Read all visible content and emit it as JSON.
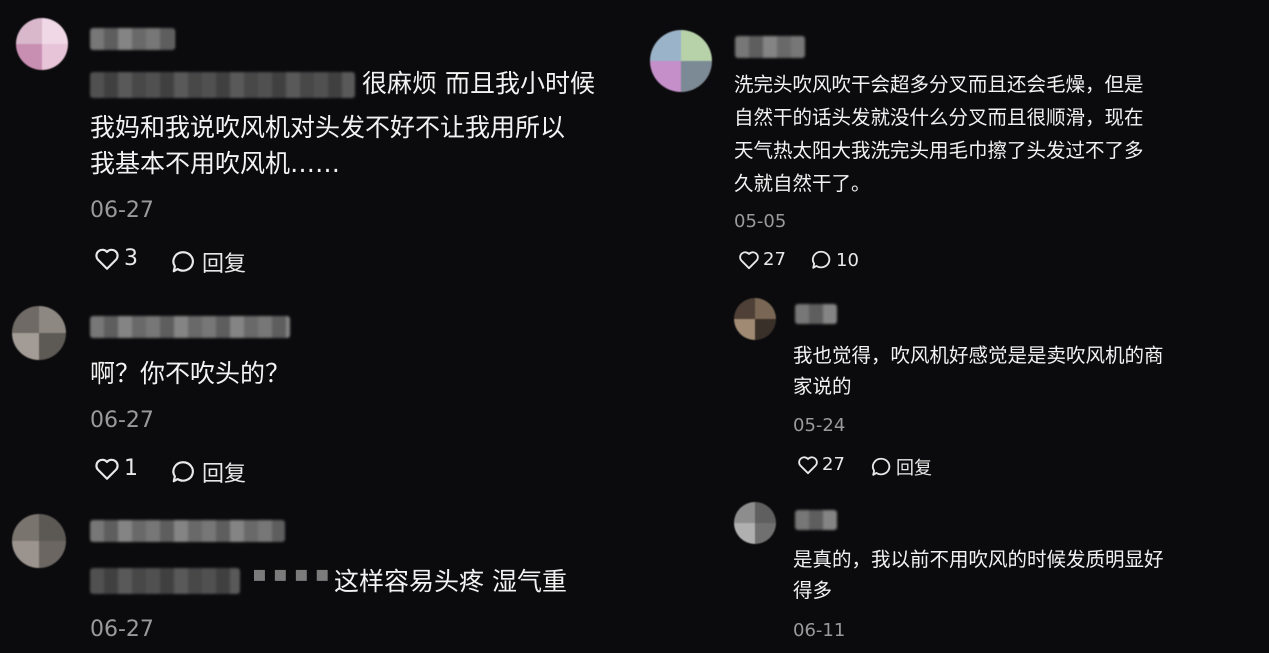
{
  "left_comments": [
    {
      "text_line1": "很麻烦 而且我小时候",
      "text_line2": "我妈和我说吹风机对头发不好不让我用所以",
      "text_line3": "我基本不用吹风机……",
      "date": "06-27",
      "likes": "3",
      "reply_label": "回复"
    },
    {
      "text_line1": "啊？你不吹头的？",
      "date": "06-27",
      "likes": "1",
      "reply_label": "回复"
    },
    {
      "text_line1": "这样容易头疼 湿气重",
      "date": "06-27"
    }
  ],
  "right_comment": {
    "text_line1": "洗完头吹风吹干会超多分叉而且还会毛燥，但是",
    "text_line2": "自然干的话头发就没什么分叉而且很顺滑，现在",
    "text_line3": "天气热太阳大我洗完头用毛巾擦了头发过不了多",
    "text_line4": "久就自然干了。",
    "date": "05-05",
    "likes": "27",
    "replies": "10"
  },
  "right_replies": [
    {
      "text_line1": "我也觉得，吹风机好感觉是是卖吹风机的商",
      "text_line2": "家说的",
      "date": "05-24",
      "likes": "27",
      "reply_label": "回复"
    },
    {
      "text_line1": "是真的，我以前不用吹风的时候发质明显好",
      "text_line2": "得多",
      "date": "06-11"
    }
  ],
  "icons": {
    "like": "heart-outline-icon",
    "reply": "speech-bubble-icon"
  },
  "colors": {
    "background": "#0b0b0d",
    "text": "#f2f2f2",
    "meta": "#9a9a9a"
  }
}
